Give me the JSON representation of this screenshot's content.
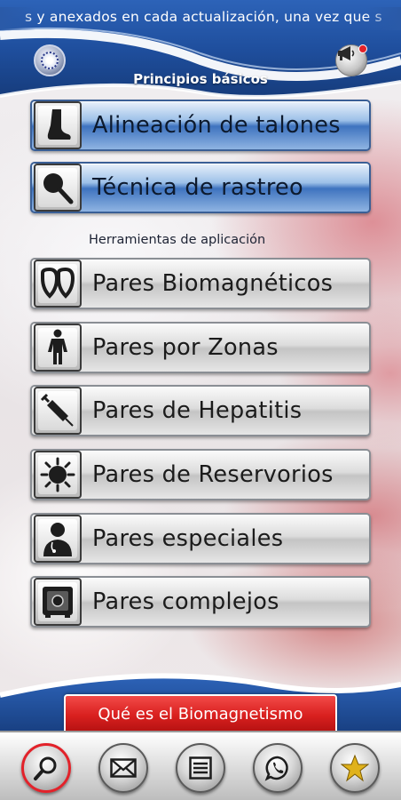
{
  "header": {
    "ticker_text": "s y anexados en cada actualización, una vez que s",
    "logo_icon": "seal-logo-icon",
    "speaker_icon": "megaphone-icon"
  },
  "sections": {
    "basic_title": "Principios básicos",
    "tools_title": "Herramientas de aplicación"
  },
  "menu": [
    {
      "label": "Alineación de talones",
      "icon": "foot-icon",
      "style": "blue"
    },
    {
      "label": "Técnica de rastreo",
      "icon": "magnet-probe-icon",
      "style": "blue"
    },
    {
      "label": "Pares Biomagnéticos",
      "icon": "magnets-pair-icon",
      "style": "silver"
    },
    {
      "label": "Pares por Zonas",
      "icon": "human-body-icon",
      "style": "silver"
    },
    {
      "label": "Pares de Hepatitis",
      "icon": "syringe-icon",
      "style": "silver"
    },
    {
      "label": "Pares de Reservorios",
      "icon": "virus-icon",
      "style": "silver"
    },
    {
      "label": "Pares especiales",
      "icon": "doctor-icon",
      "style": "silver"
    },
    {
      "label": "Pares complejos",
      "icon": "safe-icon",
      "style": "silver"
    }
  ],
  "cta": {
    "label": "Qué es el Biomagnetismo"
  },
  "nav": [
    {
      "icon": "search-icon",
      "active": true
    },
    {
      "icon": "mail-icon",
      "active": false
    },
    {
      "icon": "list-icon",
      "active": false
    },
    {
      "icon": "whatsapp-icon",
      "active": false
    },
    {
      "icon": "star-icon",
      "active": false
    }
  ],
  "colors": {
    "header_blue": "#1f4f9e",
    "cta_red": "#d9201f",
    "active_ring": "#e2222a"
  }
}
